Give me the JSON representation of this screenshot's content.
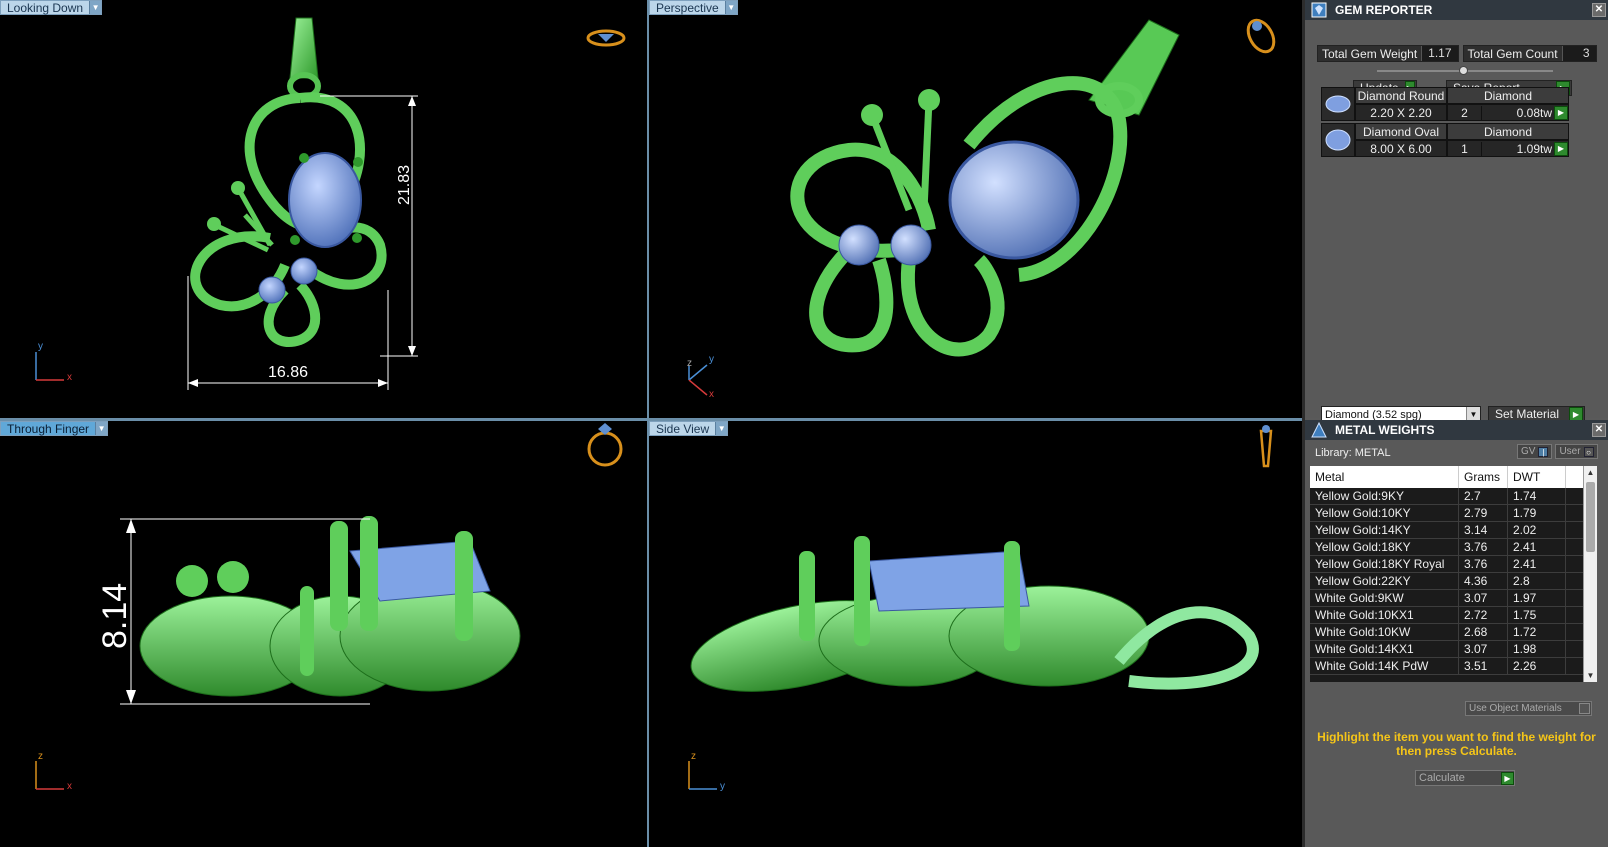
{
  "viewports": {
    "top_left": {
      "label": "Looking Down",
      "dim_height": "21.83",
      "dim_width": "16.86",
      "axis1": "y",
      "axis2": "x"
    },
    "top_right": {
      "label": "Perspective",
      "axis1": "y",
      "axis2": "z",
      "axis3": "x"
    },
    "bottom_left": {
      "label": "Through Finger",
      "dim_height": "8.14",
      "axis1": "z",
      "axis2": "x"
    },
    "bottom_right": {
      "label": "Side View",
      "axis1": "z",
      "axis2": "y"
    }
  },
  "gem_reporter": {
    "title": "GEM REPORTER",
    "total_weight_label": "Total Gem Weight",
    "total_weight_value": "1.17",
    "total_count_label": "Total Gem Count",
    "total_count_value": "3",
    "update_label": "Update",
    "save_report_label": "Save Report",
    "gems": [
      {
        "name": "Diamond Round",
        "material": "Diamond",
        "size": "2.20 X 2.20",
        "qty": "2",
        "weight": "0.08tw"
      },
      {
        "name": "Diamond Oval",
        "material": "Diamond",
        "size": "8.00 X 6.00",
        "qty": "1",
        "weight": "1.09tw"
      }
    ],
    "material_select_value": "Diamond    (3.52 spg)",
    "set_material_label": "Set Material"
  },
  "metal_weights": {
    "title": "METAL WEIGHTS",
    "library_label": "Library: METAL",
    "gv_label": "GV",
    "user_label": "User",
    "columns": [
      "Metal",
      "Grams",
      "DWT"
    ],
    "rows": [
      [
        "Yellow Gold:9KY",
        "2.7",
        "1.74"
      ],
      [
        "Yellow Gold:10KY",
        "2.79",
        "1.79"
      ],
      [
        "Yellow Gold:14KY",
        "3.14",
        "2.02"
      ],
      [
        "Yellow Gold:18KY",
        "3.76",
        "2.41"
      ],
      [
        "Yellow Gold:18KY Royal",
        "3.76",
        "2.41"
      ],
      [
        "Yellow Gold:22KY",
        "4.36",
        "2.8"
      ],
      [
        "White Gold:9KW",
        "3.07",
        "1.97"
      ],
      [
        "White Gold:10KX1",
        "2.72",
        "1.75"
      ],
      [
        "White Gold:10KW",
        "2.68",
        "1.72"
      ],
      [
        "White Gold:14KX1",
        "3.07",
        "1.98"
      ],
      [
        "White Gold:14K PdW",
        "3.51",
        "2.26"
      ]
    ],
    "use_object_materials_label": "Use Object Materials",
    "hint": "Highlight the item you want to find the weight for then press Calculate.",
    "calculate_label": "Calculate"
  },
  "colors": {
    "metal_green": "#6ee06a",
    "gem_blue": "#86a9e8",
    "label_bg": "#bcd6ea",
    "hint_yellow": "#f5c518"
  }
}
